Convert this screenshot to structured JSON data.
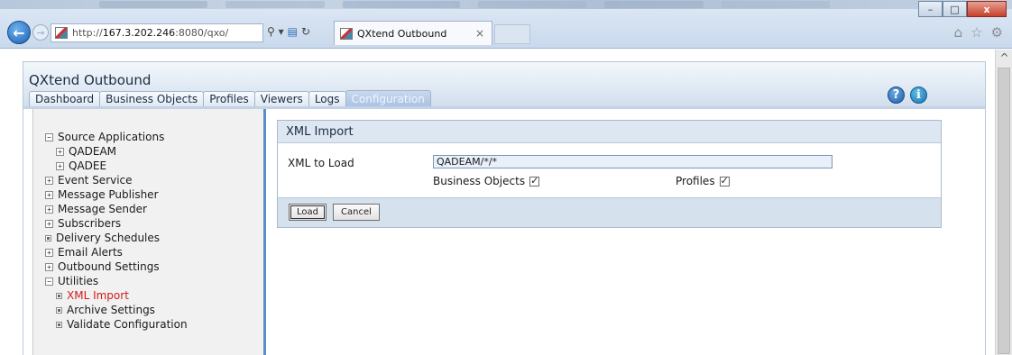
{
  "browser": {
    "address_prefix": "http://",
    "address_host": "167.3.202.246",
    "address_path": ":8080/qxo/",
    "search_glyph": "⚲ ▾",
    "tab_title": "QXtend Outbound",
    "tab_close": "×",
    "win_minimize": "–",
    "win_maximize": "□",
    "win_close": "x"
  },
  "app": {
    "title": "QXtend Outbound",
    "help_glyph": "?",
    "info_glyph": "i",
    "tabs": [
      {
        "label": "Dashboard"
      },
      {
        "label": "Business Objects"
      },
      {
        "label": "Profiles"
      },
      {
        "label": "Viewers"
      },
      {
        "label": "Logs"
      },
      {
        "label": "Configuration"
      }
    ]
  },
  "tree": [
    {
      "label": "Source Applications",
      "toggle": "−"
    },
    {
      "label": "QADEAM",
      "toggle": "+"
    },
    {
      "label": "QADEE",
      "toggle": "+"
    },
    {
      "label": "Event Service",
      "toggle": "+"
    },
    {
      "label": "Message Publisher",
      "toggle": "+"
    },
    {
      "label": "Message Sender",
      "toggle": "+"
    },
    {
      "label": "Subscribers",
      "toggle": "+"
    },
    {
      "label": "Delivery Schedules"
    },
    {
      "label": "Email Alerts",
      "toggle": "+"
    },
    {
      "label": "Outbound Settings",
      "toggle": "+"
    },
    {
      "label": "Utilities",
      "toggle": "−"
    },
    {
      "label": "XML Import"
    },
    {
      "label": "Archive Settings"
    },
    {
      "label": "Validate Configuration"
    }
  ],
  "xml_import": {
    "title": "XML Import",
    "load_label": "XML to Load",
    "load_value": "QADEAM/*/*",
    "business_objects_label": "Business Objects",
    "business_objects_checked": true,
    "profiles_label": "Profiles",
    "profiles_checked": true,
    "load_button": "Load",
    "cancel_button": "Cancel"
  }
}
